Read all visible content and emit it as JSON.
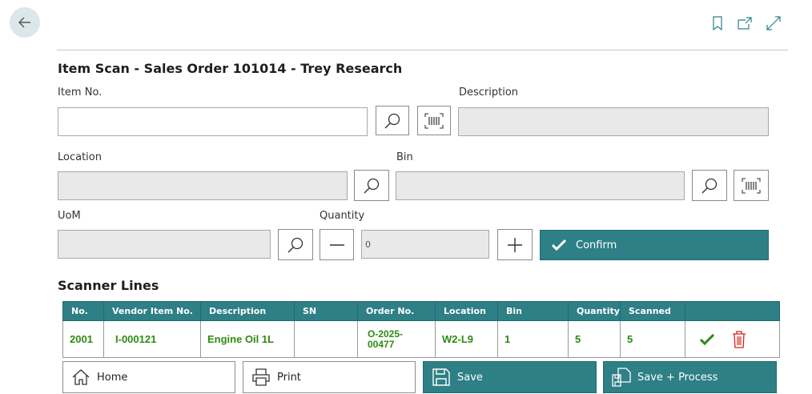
{
  "page": {
    "title": "Item Scan - Sales Order 101014 - Trey Research"
  },
  "fields": {
    "item_no": {
      "label": "Item No.",
      "value": ""
    },
    "description": {
      "label": "Description",
      "value": ""
    },
    "location": {
      "label": "Location",
      "value": ""
    },
    "bin": {
      "label": "Bin",
      "value": ""
    },
    "uom": {
      "label": "UoM",
      "value": ""
    },
    "quantity": {
      "label": "Quantity",
      "value": "0"
    }
  },
  "confirm_label": "Confirm",
  "scanner_lines": {
    "title": "Scanner Lines",
    "columns": [
      "No.",
      "Vendor Item No.",
      "Description",
      "SN",
      "Order No.",
      "Location",
      "Bin",
      "Quantity",
      "Scanned",
      ""
    ],
    "rows": [
      {
        "no": "2001",
        "vendor_item_no": "I-000121",
        "description": "Engine Oil 1L",
        "sn": "",
        "order_no": "O-2025-00477",
        "location": "W2-L9",
        "bin": "1",
        "quantity": "5",
        "scanned": "5"
      }
    ]
  },
  "buttons": {
    "home": "Home",
    "print": "Print",
    "save": "Save",
    "save_process": "Save + Process"
  },
  "colors": {
    "accent": "#2e7f86",
    "row_text": "#2e8b12",
    "delete": "#d9241c"
  },
  "icons": [
    "back-arrow-icon",
    "bookmark-icon",
    "open-new-window-icon",
    "expand-icon",
    "search-icon",
    "barcode-icon",
    "minus-icon",
    "plus-icon",
    "checkmark-icon",
    "trash-icon",
    "home-icon",
    "print-icon",
    "save-icon",
    "save-process-icon"
  ]
}
